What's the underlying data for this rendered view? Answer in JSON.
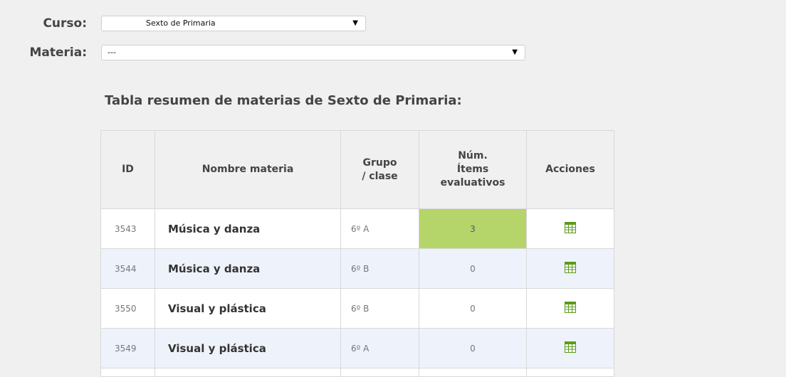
{
  "form": {
    "curso_label": "Curso:",
    "curso_value": "Sexto de Primaria",
    "materia_label": "Materia:",
    "materia_value": "---"
  },
  "table": {
    "title": "Tabla resumen de materias de Sexto de Primaria:",
    "headers": {
      "id": "ID",
      "name": "Nombre materia",
      "group_line1": "Grupo",
      "group_line2": "/ clase",
      "items_line1": "Núm.",
      "items_line2": "Ítems",
      "items_line3": "evaluativos",
      "actions": "Acciones"
    },
    "rows": [
      {
        "id": "3543",
        "name": "Música y danza",
        "group": "6º A",
        "items": "3",
        "highlight": true
      },
      {
        "id": "3544",
        "name": "Música y danza",
        "group": "6º B",
        "items": "0",
        "highlight": false
      },
      {
        "id": "3550",
        "name": "Visual y plástica",
        "group": "6º B",
        "items": "0",
        "highlight": false
      },
      {
        "id": "3549",
        "name": "Visual y plástica",
        "group": "6º A",
        "items": "0",
        "highlight": false
      }
    ]
  },
  "colors": {
    "highlight": "#b5d46a",
    "icon_green": "#5a9a1a",
    "row_alt": "#eef2fb"
  },
  "icons": {
    "action": "table-grid-icon",
    "dropdown": "chevron-down-icon"
  }
}
